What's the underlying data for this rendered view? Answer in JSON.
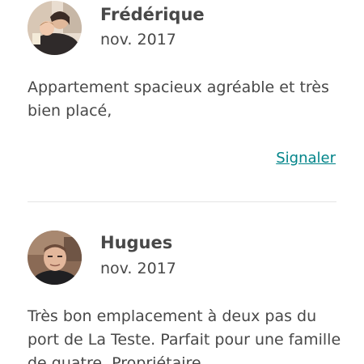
{
  "reviews": [
    {
      "name": "Frédérique",
      "date": "nov. 2017",
      "text": "Appartement spacieux agréable et très bien placé,",
      "report_label": "Signaler",
      "avatar_icon": "user-photo-avatar"
    },
    {
      "name": "Hugues",
      "date": "nov. 2017",
      "text": "Très bon emplacement à deux pas du port de La Teste. Parfait pour une famille de quatre. Propriétaire",
      "avatar_icon": "user-photo-avatar"
    }
  ],
  "colors": {
    "text": "#484848",
    "link": "#008489",
    "divider": "#e4e4e4"
  }
}
